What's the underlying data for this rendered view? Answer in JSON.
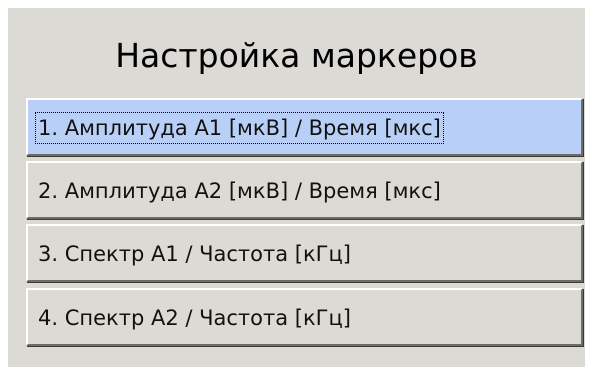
{
  "dialog": {
    "title": "Настройка маркеров"
  },
  "menu": {
    "items": [
      {
        "label": "1. Амплитуда А1 [мкВ] / Время [мкс]",
        "selected": true
      },
      {
        "label": "2. Амплитуда А2 [мкВ] / Время [мкс]",
        "selected": false
      },
      {
        "label": "3. Спектр А1 / Частота [кГц]",
        "selected": false
      },
      {
        "label": "4. Спектр А2 / Частота [кГц]",
        "selected": false
      }
    ]
  },
  "colors": {
    "panel_background": "#dcdad5",
    "selected_background": "#b8d0f7"
  }
}
